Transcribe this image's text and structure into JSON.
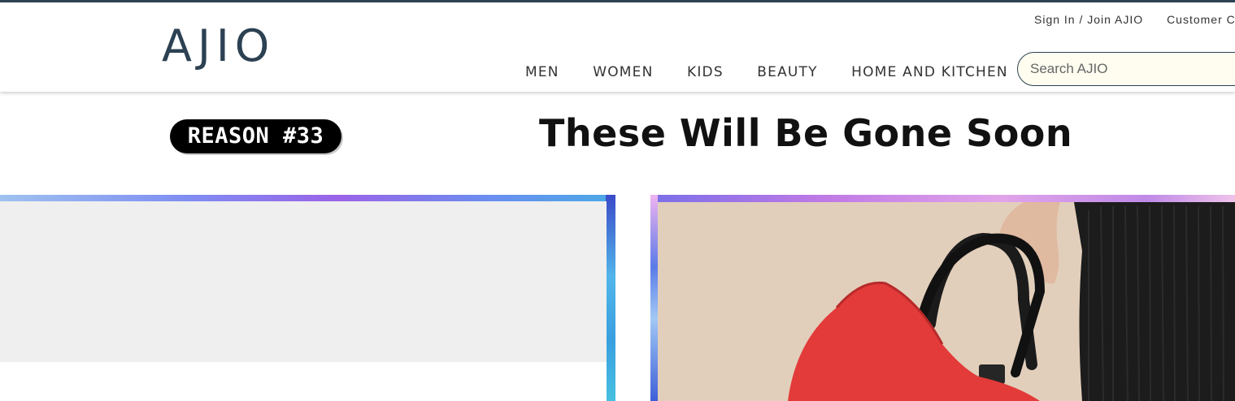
{
  "header": {
    "logo": "AJIO",
    "top_links": {
      "sign_in": "Sign In / Join AJIO",
      "customer_care": "Customer Care"
    },
    "nav": [
      "MEN",
      "WOMEN",
      "KIDS",
      "BEAUTY",
      "HOME AND KITCHEN"
    ],
    "search": {
      "placeholder": "Search AJIO",
      "value": ""
    }
  },
  "section": {
    "badge": "REASON #33",
    "title": "These Will Be Gone Soon"
  },
  "cards": [
    {
      "kind": "image-placeholder"
    },
    {
      "kind": "product-image",
      "subject": "red handbag held by hand"
    }
  ],
  "colors": {
    "brand": "#2c4152",
    "bag_red": "#e23b3a",
    "photo_bg": "#e2cfbb"
  },
  "icons": [
    "search-icon"
  ]
}
